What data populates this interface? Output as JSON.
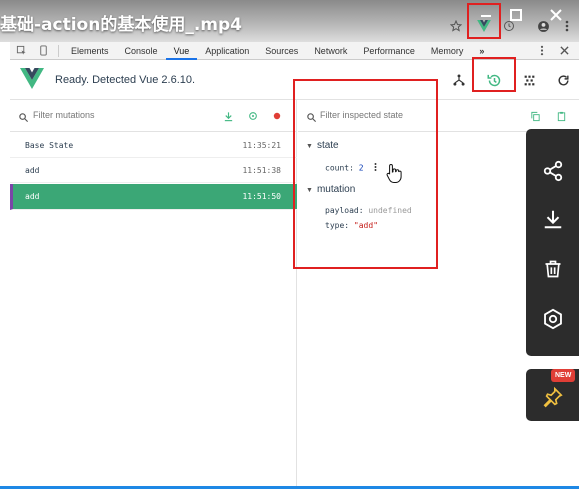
{
  "video": {
    "title": "基础-action的基本使用_.mp4"
  },
  "devtools": {
    "tabs": [
      {
        "label": "Elements"
      },
      {
        "label": "Console"
      },
      {
        "label": "Vue"
      },
      {
        "label": "Application"
      },
      {
        "label": "Sources"
      },
      {
        "label": "Network"
      },
      {
        "label": "Performance"
      },
      {
        "label": "Memory"
      }
    ],
    "overflow_label": "»",
    "active_tab": "Vue"
  },
  "vue": {
    "status_text": "Ready. Detected Vue 2.6.10.",
    "accent_color": "#42b883",
    "dark_color": "#35495e"
  },
  "mutations_panel": {
    "filter_placeholder": "Filter mutations",
    "rows": [
      {
        "name": "Base State",
        "time": "11:35:21",
        "selected": false
      },
      {
        "name": "add",
        "time": "11:51:38",
        "selected": false
      },
      {
        "name": "add",
        "time": "11:51:50",
        "selected": true
      }
    ],
    "selected_color": "#3ba776"
  },
  "state_panel": {
    "filter_placeholder": "Filter inspected state",
    "state_section": {
      "title": "state",
      "entries": [
        {
          "key": "count:",
          "value": "2"
        }
      ]
    },
    "mutation_section": {
      "title": "mutation",
      "entries": [
        {
          "key": "payload:",
          "value": "undefined"
        },
        {
          "key": "type:",
          "value": "\"add\""
        }
      ]
    }
  },
  "side_toolbar": {
    "buttons": [
      "share-icon",
      "download-icon",
      "trash-icon",
      "settings-icon"
    ],
    "pin_badge": "NEW"
  },
  "annotation_color": "#e02020"
}
